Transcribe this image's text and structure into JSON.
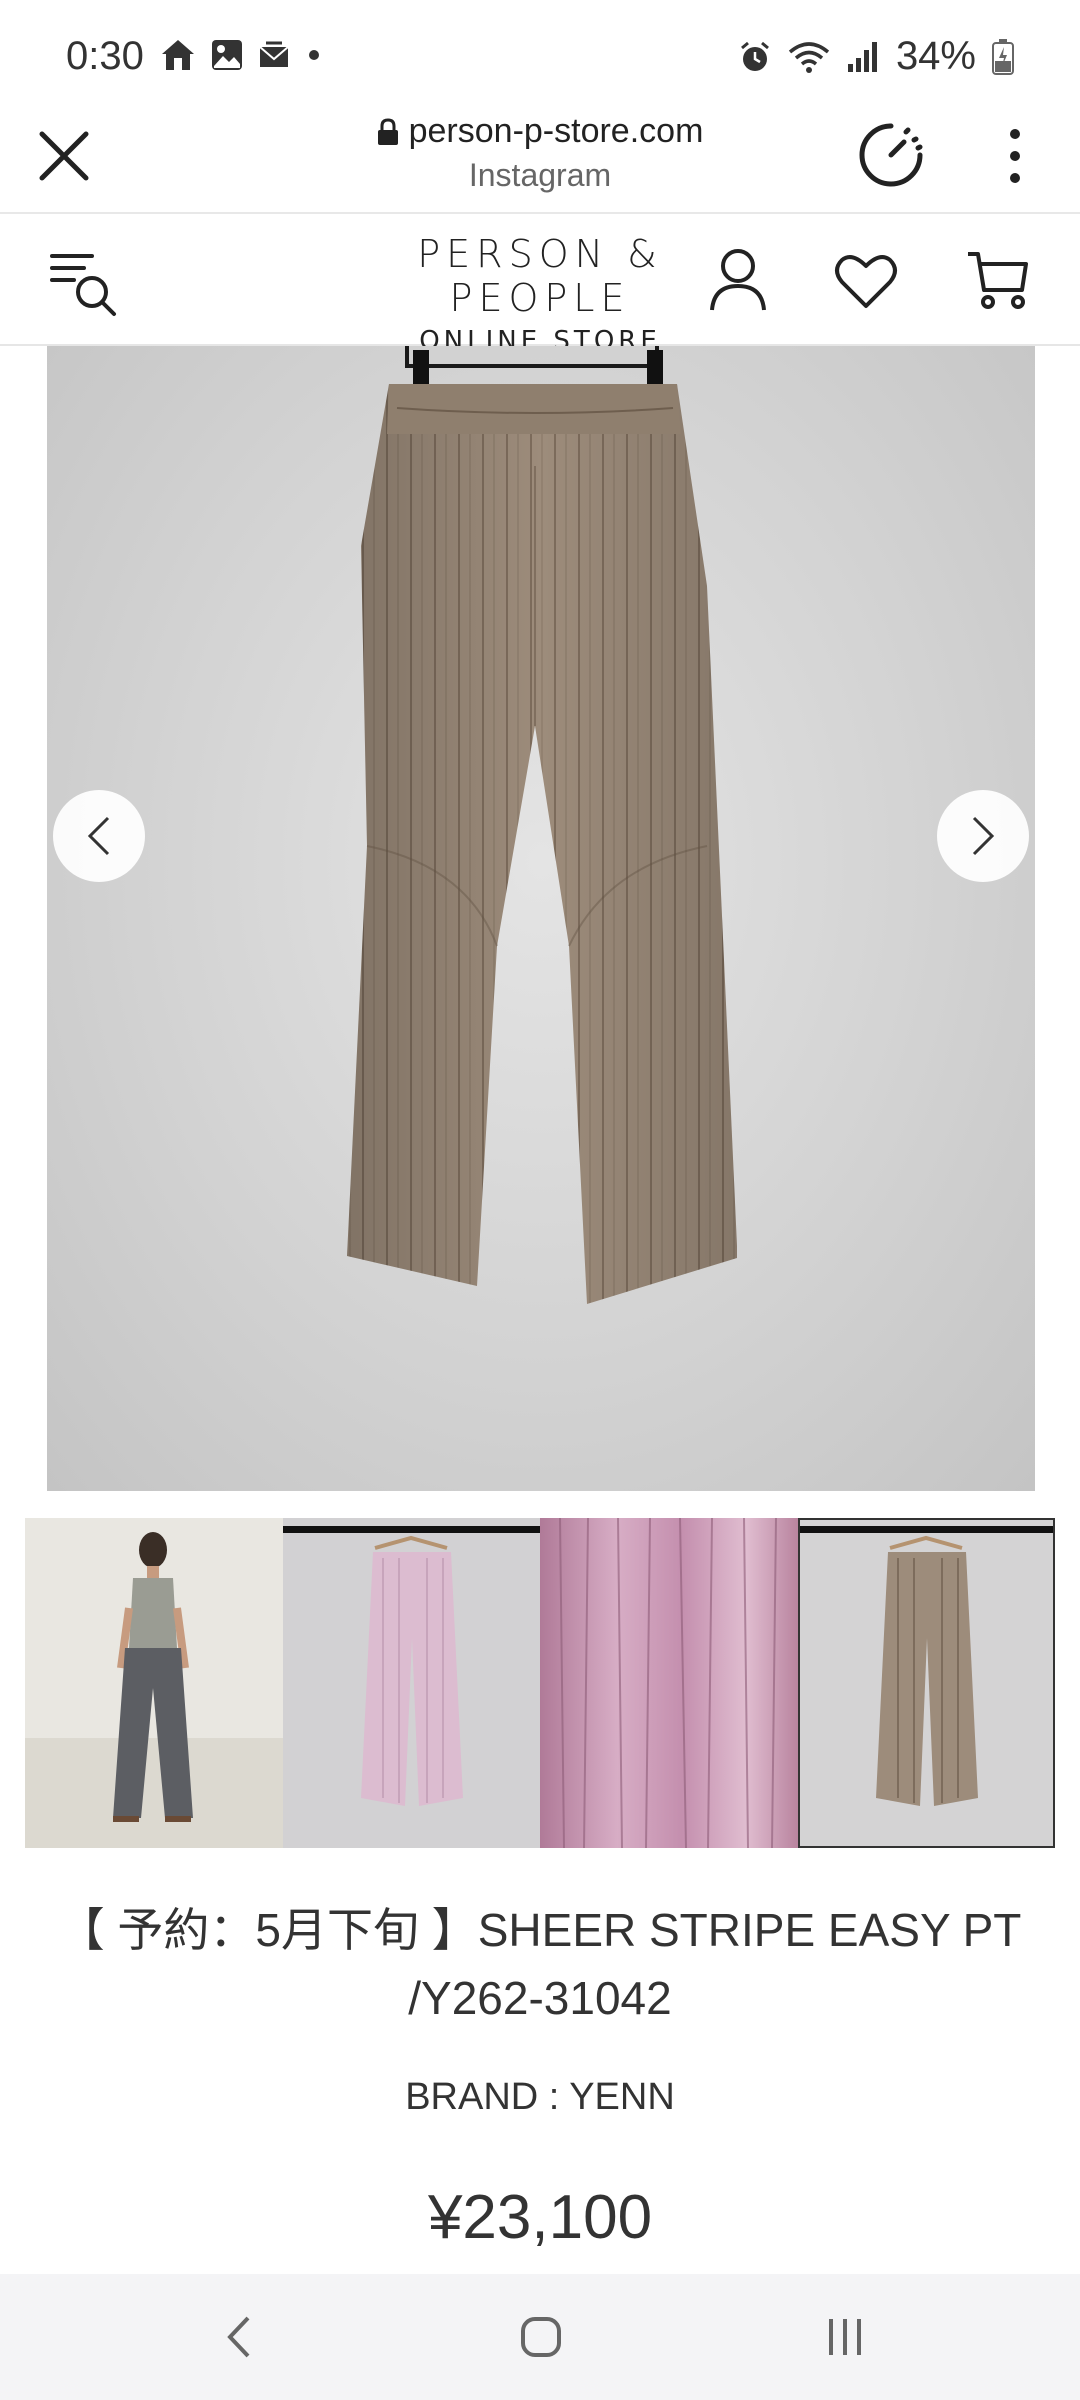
{
  "status_bar": {
    "time": "0:30",
    "battery": "34%",
    "left_icons": [
      "home-icon",
      "gallery-icon",
      "mail-icon",
      "dot-icon"
    ],
    "right_icons": [
      "alarm-icon",
      "wifi-icon",
      "signal-icon",
      "battery-icon"
    ]
  },
  "browser": {
    "url": "person-p-store.com",
    "source": "Instagram"
  },
  "site_header": {
    "logo_line1": "PERSON & PEOPLE",
    "logo_line2": "ONLINE STORE",
    "icons": [
      "menu-search-icon",
      "account-icon",
      "heart-icon",
      "cart-icon"
    ]
  },
  "gallery": {
    "main_alt": "beige striped sheer pants on hanger",
    "thumbnails": [
      {
        "label": "model wearing charcoal pants",
        "active": false
      },
      {
        "label": "pink pants on hanger",
        "active": false
      },
      {
        "label": "pink fabric close-up",
        "active": false
      },
      {
        "label": "beige pants on hanger",
        "active": true
      }
    ]
  },
  "product": {
    "title": "【 予約：5月下旬 】SHEER STRIPE EASY PT /Y262-31042",
    "brand": "BRAND : YENN",
    "price": "¥23,100"
  },
  "colors": {
    "text": "#333333",
    "beige": "#9a8a78",
    "pink": "#d8b3c9"
  }
}
